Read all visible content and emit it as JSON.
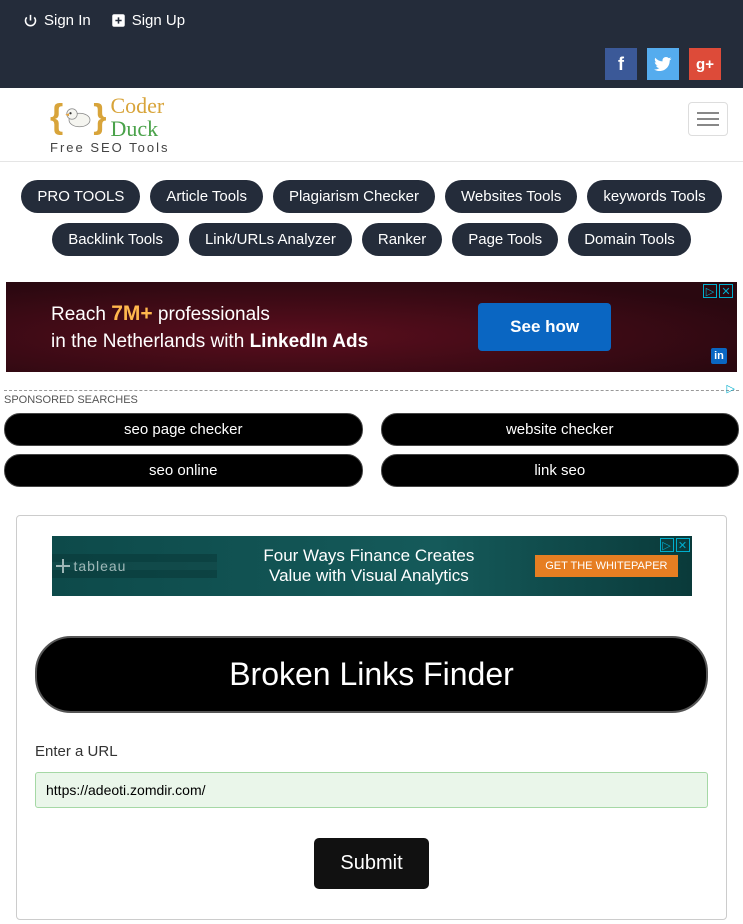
{
  "topbar": {
    "signin": "Sign In",
    "signup": "Sign Up"
  },
  "social": {
    "fb": "f",
    "tw": "t",
    "gp": "g+"
  },
  "logo": {
    "line1": "Coder",
    "line2": "Duck",
    "sub": "Free SEO Tools"
  },
  "nav": [
    "PRO TOOLS",
    "Article Tools",
    "Plagiarism Checker",
    "Websites Tools",
    "keywords Tools",
    "Backlink Tools",
    "Link/URLs Analyzer",
    "Ranker",
    "Page Tools",
    "Domain Tools"
  ],
  "ad1": {
    "reach_prefix": "Reach ",
    "reach_highlight": "7M+",
    "reach_suffix": " professionals",
    "line2_prefix": "in the Netherlands with ",
    "line2_bold": "LinkedIn Ads",
    "cta": "See how"
  },
  "sponsored": {
    "label": "SPONSORED SEARCHES",
    "items": [
      "seo page checker",
      "website checker",
      "seo online",
      "link seo"
    ]
  },
  "ad2": {
    "brand": "tableau",
    "line1": "Four Ways Finance Creates",
    "line2": "Value with Visual Analytics",
    "cta": "GET THE WHITEPAPER"
  },
  "tool": {
    "title": "Broken Links Finder",
    "input_label": "Enter a URL",
    "input_value": "https://adeoti.zomdir.com/",
    "submit": "Submit"
  }
}
